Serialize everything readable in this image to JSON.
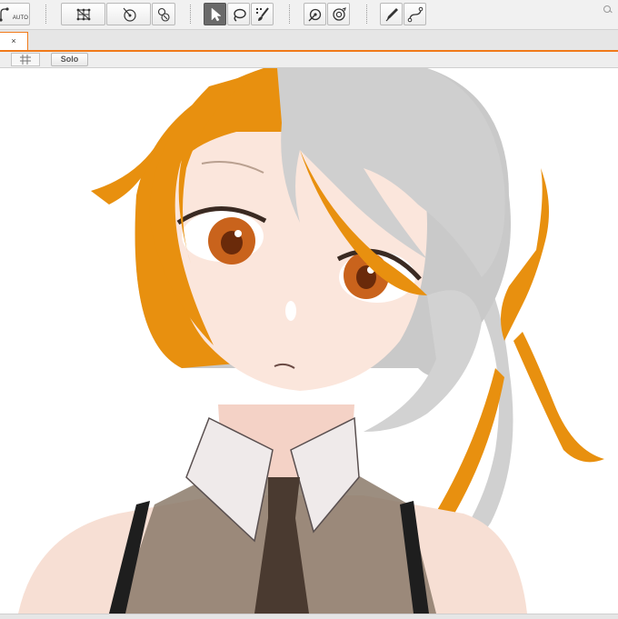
{
  "toolbar": {
    "auto_label": "AUTO",
    "tools": [
      {
        "name": "auto-mesh",
        "icon": "auto-mesh-icon"
      },
      {
        "name": "mesh-edit",
        "icon": "mesh-grid-icon"
      },
      {
        "name": "deform-rotate",
        "icon": "rotation-deformer-icon"
      },
      {
        "name": "deform-warp",
        "icon": "warp-deformer-icon"
      },
      {
        "name": "arrow-select",
        "icon": "arrow-cursor-icon",
        "selected": true
      },
      {
        "name": "lasso-select",
        "icon": "lasso-icon"
      },
      {
        "name": "brush-select",
        "icon": "brush-select-icon"
      },
      {
        "name": "glue",
        "icon": "glue-icon"
      },
      {
        "name": "parameter",
        "icon": "parameter-icon"
      },
      {
        "name": "pen",
        "icon": "pen-icon"
      },
      {
        "name": "path",
        "icon": "path-curve-icon"
      }
    ]
  },
  "tabbar": {
    "close_glyph": "×"
  },
  "subbar": {
    "solo_label": "Solo",
    "grid_icon": "grid-icon"
  },
  "colors": {
    "accent": "#f07a1a",
    "hair_orange": "#e8900f",
    "hair_silver": "#c8c8c8",
    "skin": "#fbe6dc",
    "eye": "#c9631c",
    "shirt": "#8b7a6a",
    "tie": "#4a3a30"
  }
}
